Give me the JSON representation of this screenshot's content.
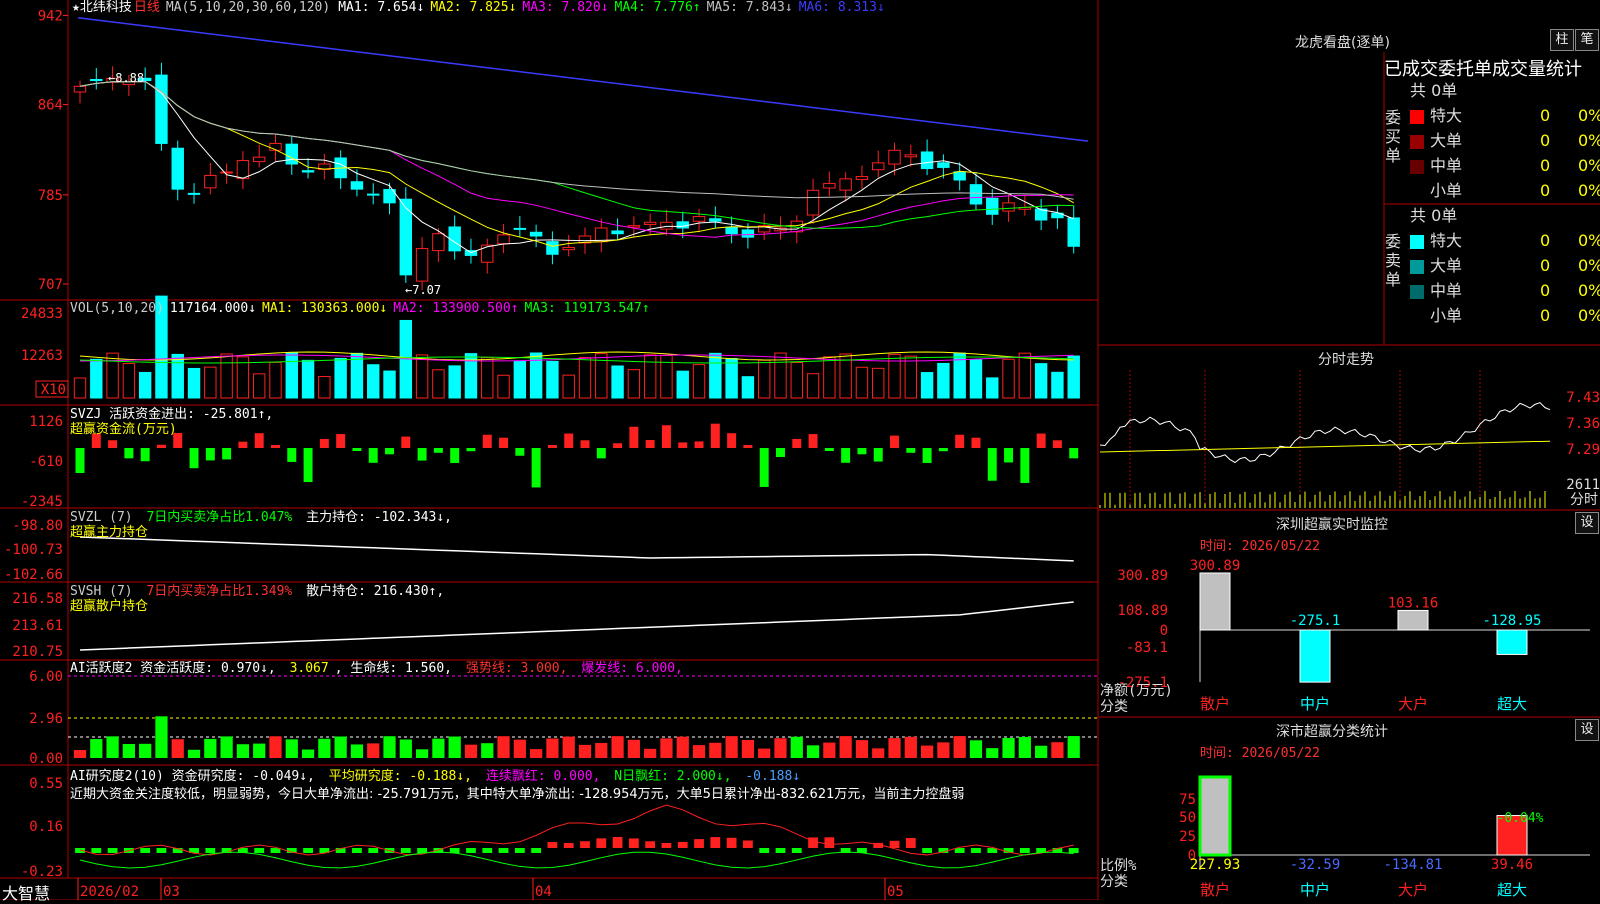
{
  "app": {
    "name": "大智慧",
    "ticker": "★北纬科技",
    "period": "日线"
  },
  "main_header": {
    "ma_label": "MA(5,10,20,30,60,120)",
    "items": [
      {
        "text": "MA1: 7.654↓",
        "color": "#ffffff"
      },
      {
        "text": "MA2: 7.825↓",
        "color": "#ffff00"
      },
      {
        "text": "MA3: 7.820↓",
        "color": "#ff00ff"
      },
      {
        "text": "MA4: 7.776↑",
        "color": "#00ff00"
      },
      {
        "text": "MA5: 7.843↓",
        "color": "#c0c0c0"
      },
      {
        "text": "MA6: 8.313↓",
        "color": "#3b3bff"
      }
    ],
    "price_ticks": [
      "942",
      "864",
      "785",
      "707"
    ],
    "high_note": "←8.88",
    "low_note": "←7.07"
  },
  "vol_header": {
    "items": [
      {
        "text": "VOL(5,10,20)",
        "color": "#cccccc"
      },
      {
        "text": "117164.000↓",
        "color": "#ffffff"
      },
      {
        "text": "MA1: 130363.000↓",
        "color": "#ffff00"
      },
      {
        "text": "MA2: 133900.500↑",
        "color": "#ff00ff"
      },
      {
        "text": "MA3: 119173.547↑",
        "color": "#00ff00"
      }
    ],
    "ticks": [
      "24833",
      "12263"
    ],
    "unit": "X10"
  },
  "svzj_header": {
    "line1": "SVZJ  活跃资金进出: -25.801↑,",
    "line2": "超赢资金流(万元)",
    "ticks": [
      "1126",
      "-610",
      "-2345"
    ]
  },
  "svzl_header": {
    "parts": [
      {
        "text": "SVZL (7) ",
        "color": "#cccccc"
      },
      {
        "text": "7日内买卖净占比1.047%",
        "color": "#00ff00"
      },
      {
        "text": " 主力持仓: -102.343↓,",
        "color": "#ffffff"
      }
    ],
    "line2": "超赢主力持仓",
    "ticks": [
      "-98.80",
      "-100.73",
      "-102.66"
    ]
  },
  "svsh_header": {
    "parts": [
      {
        "text": "SVSH (7) ",
        "color": "#cccccc"
      },
      {
        "text": "7日内买卖净占比1.349%",
        "color": "#ff3030"
      },
      {
        "text": " 散户持仓: 216.430↑,",
        "color": "#ffffff"
      }
    ],
    "line2": "超赢散户持仓",
    "ticks": [
      "216.58",
      "213.61",
      "210.75"
    ]
  },
  "ai_hy_header": {
    "parts": [
      {
        "text": "AI活跃度2 资金活跃度: 0.970↓, ",
        "color": "#ffffff"
      },
      {
        "text": "3.067",
        "color": "#ffff00"
      },
      {
        "text": ", 生命线: 1.560, ",
        "color": "#ffffff"
      },
      {
        "text": "强势线: 3.000, ",
        "color": "#ff3030"
      },
      {
        "text": "爆发线: 6.000,",
        "color": "#ff00ff"
      }
    ],
    "ticks": [
      "6.00",
      "2.96",
      "0.00"
    ]
  },
  "ai_yj_header": {
    "parts": [
      {
        "text": "AI研究度2(10) 资金研究度: -0.049↓, ",
        "color": "#ffffff"
      },
      {
        "text": "平均研究度: -0.188↓, ",
        "color": "#ffff00"
      },
      {
        "text": "连续飘红: 0.000, ",
        "color": "#ff00ff"
      },
      {
        "text": "N日飘红: 2.000↓, ",
        "color": "#00ff00"
      },
      {
        "text": "-0.188↓",
        "color": "#4aa0ff"
      }
    ],
    "note": "近期大资金关注度较低，明显弱势，今日大单净流出: -25.791万元，其中特大单净流出: -128.954万元，大单5日累计净出-832.621万元，当前主力控盘弱",
    "ticks": [
      "0.55",
      "0.16",
      "-0.23"
    ]
  },
  "date_axis": {
    "labels": [
      "2026/02",
      "03",
      "04",
      "05"
    ]
  },
  "dragon": {
    "title": "龙虎看盘(逐单)",
    "btn_zhu": "柱",
    "btn_bi": "笔",
    "tabs": "已成交委托单成交量统计",
    "buy": {
      "side": "委买单",
      "total": "共 0单",
      "rows": [
        {
          "label": "特大",
          "count": "0",
          "pct": "0%",
          "color": "#ff0000"
        },
        {
          "label": "大单",
          "count": "0",
          "pct": "0%",
          "color": "#990000"
        },
        {
          "label": "中单",
          "count": "0",
          "pct": "0%",
          "color": "#660000"
        },
        {
          "label": "小单",
          "count": "0",
          "pct": "0%",
          "color": "#000000"
        }
      ]
    },
    "sell": {
      "side": "委卖单",
      "total": "共 0单",
      "rows": [
        {
          "label": "特大",
          "count": "0",
          "pct": "0%",
          "color": "#00ffff"
        },
        {
          "label": "大单",
          "count": "0",
          "pct": "0%",
          "color": "#009a9a"
        },
        {
          "label": "中单",
          "count": "0",
          "pct": "0%",
          "color": "#006b6b"
        },
        {
          "label": "小单",
          "count": "0",
          "pct": "0%",
          "color": "#000000"
        }
      ]
    }
  },
  "intraday": {
    "title": "分时走势",
    "ticks": [
      "7.43",
      "7.36",
      "7.29",
      "2611"
    ],
    "unit": "分时"
  },
  "sz_monitor": {
    "title": "深圳超赢实时监控",
    "btn": "设",
    "time": "时间: 2026/05/22",
    "ticks": [
      "300.89",
      "108.89",
      "0",
      "-83.1",
      "-275.1"
    ],
    "axis_label1": "净额(万元)",
    "axis_label2": "分类",
    "categories": [
      "散户",
      "中户",
      "大户",
      "超大"
    ],
    "values": [
      300.89,
      -275.1,
      103.16,
      -128.95
    ],
    "value_labels": [
      "300.89",
      "-275.1",
      "103.16",
      "-128.95"
    ]
  },
  "sz_stats": {
    "title": "深市超赢分类统计",
    "btn": "设",
    "time": "时间: 2026/05/22",
    "ticks": [
      "75",
      "50",
      "25",
      "0"
    ],
    "axis_label1": "比例%",
    "axis_label2": "分类",
    "categories": [
      "散户",
      "中户",
      "大户",
      "超大"
    ],
    "values": [
      227.93,
      -32.59,
      -134.81,
      39.46
    ],
    "value_labels": [
      "227.93",
      "-32.59",
      "-134.81",
      "39.46"
    ],
    "pct_note": "-0.04%"
  },
  "chart_data": [
    {
      "type": "candlestick",
      "title": "北纬科技 日线",
      "ylim": [
        7.0,
        9.45
      ],
      "x": [
        "2026/02",
        "",
        "",
        "",
        "",
        "",
        "",
        "",
        "",
        "",
        "",
        "",
        "",
        "",
        "",
        "",
        "",
        "",
        "",
        "",
        "",
        "03",
        "",
        "",
        "",
        "",
        "",
        "",
        "",
        "",
        "",
        "",
        "",
        "",
        "",
        "",
        "",
        "",
        "",
        "",
        "",
        "",
        "04",
        "",
        "",
        "",
        "",
        "",
        "",
        "",
        "",
        "",
        "",
        "",
        "",
        "",
        "",
        "",
        "",
        "",
        "",
        "",
        "",
        "05",
        "",
        "",
        "",
        "",
        "",
        "",
        "",
        "",
        "",
        ""
      ],
      "series": [
        {
          "name": "close_approx",
          "values": [
            8.8,
            8.85,
            8.87,
            8.84,
            8.85,
            8.3,
            7.9,
            7.86,
            8.02,
            8.05,
            8.15,
            8.18,
            8.3,
            8.12,
            8.05,
            8.12,
            8.0,
            7.9,
            7.85,
            7.78,
            7.15,
            7.38,
            7.51,
            7.36,
            7.32,
            7.41,
            7.5,
            7.55,
            7.49,
            7.33,
            7.39,
            7.49,
            7.56,
            7.51,
            7.58,
            7.61,
            7.61,
            7.56,
            7.66,
            7.62,
            7.51,
            7.48,
            7.58,
            7.56,
            7.62,
            7.89,
            7.95,
            7.99,
            8.01,
            8.13,
            8.24,
            8.2,
            8.08,
            8.09,
            7.98,
            7.77,
            7.68,
            7.78,
            7.74,
            7.63,
            7.65,
            7.4
          ]
        }
      ]
    },
    {
      "type": "bar",
      "title": "VOL(5,10,20)",
      "ylim": [
        0,
        30000
      ]
    },
    {
      "type": "bar",
      "title": "SVZJ",
      "ylim": [
        -2345,
        1126
      ]
    },
    {
      "type": "line",
      "title": "SVZL",
      "ylim": [
        -102.66,
        -98.8
      ]
    },
    {
      "type": "line",
      "title": "SVSH",
      "ylim": [
        210.75,
        216.58
      ]
    },
    {
      "type": "bar",
      "title": "AI活跃度2",
      "ylim": [
        0,
        6
      ]
    },
    {
      "type": "bar",
      "title": "AI研究度2(10)",
      "ylim": [
        -0.23,
        0.55
      ]
    },
    {
      "type": "bar",
      "title": "深圳超赢实时监控",
      "categories": [
        "散户",
        "中户",
        "大户",
        "超大"
      ],
      "values": [
        300.89,
        -275.1,
        103.16,
        -128.95
      ]
    },
    {
      "type": "bar",
      "title": "深市超赢分类统计",
      "categories": [
        "散户",
        "中户",
        "大户",
        "超大"
      ],
      "values": [
        227.93,
        -32.59,
        -134.81,
        39.46
      ]
    }
  ]
}
